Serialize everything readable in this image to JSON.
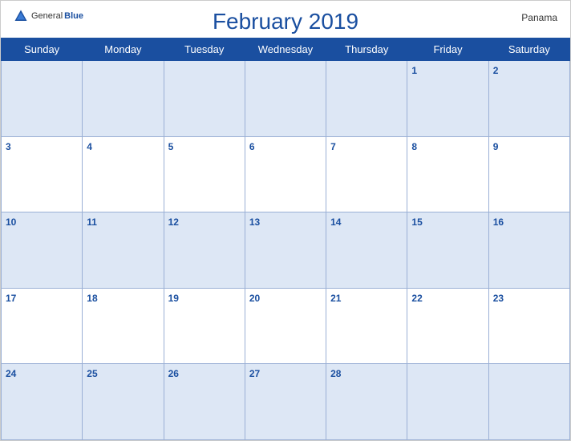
{
  "header": {
    "brand_general": "General",
    "brand_blue": "Blue",
    "month_year": "February 2019",
    "country": "Panama"
  },
  "days_of_week": [
    "Sunday",
    "Monday",
    "Tuesday",
    "Wednesday",
    "Thursday",
    "Friday",
    "Saturday"
  ],
  "weeks": [
    [
      null,
      null,
      null,
      null,
      null,
      1,
      2
    ],
    [
      3,
      4,
      5,
      6,
      7,
      8,
      9
    ],
    [
      10,
      11,
      12,
      13,
      14,
      15,
      16
    ],
    [
      17,
      18,
      19,
      20,
      21,
      22,
      23
    ],
    [
      24,
      25,
      26,
      27,
      28,
      null,
      null
    ]
  ]
}
